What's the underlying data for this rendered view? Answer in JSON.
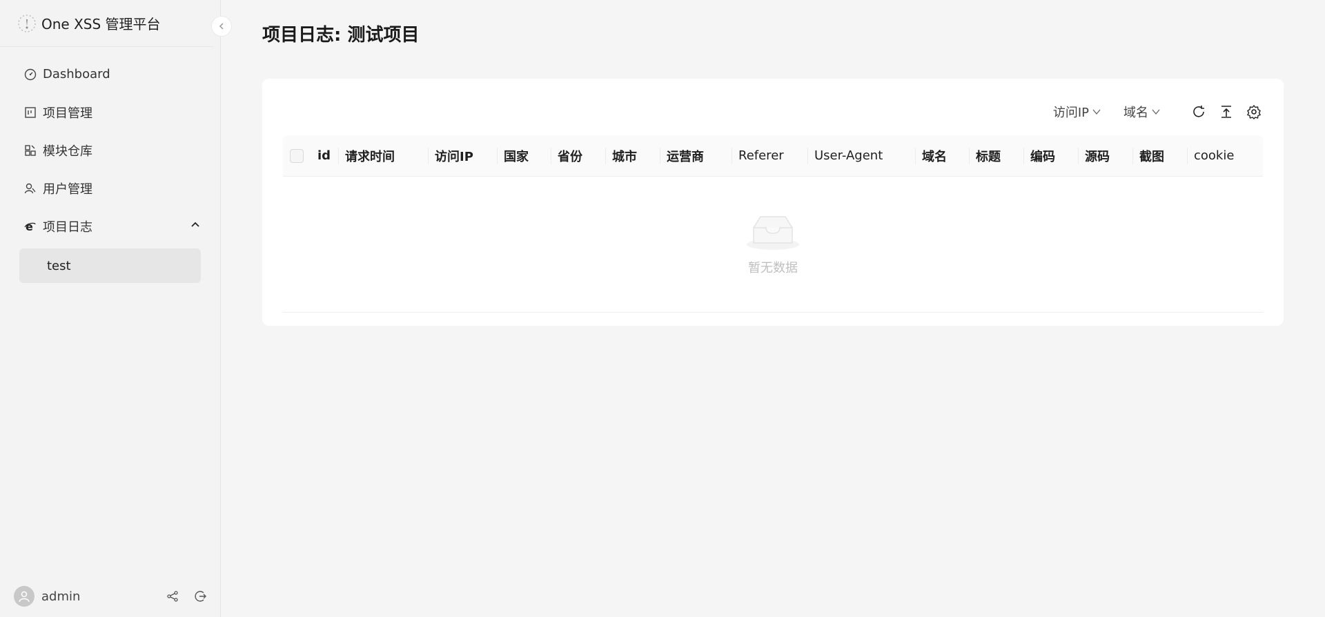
{
  "app": {
    "title": "One XSS 管理平台"
  },
  "sidebar": {
    "items": [
      {
        "label": "Dashboard"
      },
      {
        "label": "项目管理"
      },
      {
        "label": "模块仓库"
      },
      {
        "label": "用户管理"
      },
      {
        "label": "项目日志",
        "expanded": true
      }
    ],
    "subitems": [
      {
        "label": "test",
        "selected": true
      }
    ],
    "user": {
      "name": "admin"
    }
  },
  "main": {
    "title": "项目日志: 测试项目",
    "toolbar": {
      "filter1": "访问IP",
      "filter2": "域名"
    },
    "table": {
      "columns": [
        "id",
        "请求时间",
        "访问IP",
        "国家",
        "省份",
        "城市",
        "运营商",
        "Referer",
        "User-Agent",
        "域名",
        "标题",
        "编码",
        "源码",
        "截图",
        "cookie"
      ],
      "empty_text": "暂无数据"
    }
  },
  "icons": {
    "logo": "logo-icon",
    "collapse": "chevron-left-icon",
    "dashboard": "dashboard-icon",
    "project": "project-icon",
    "module": "module-icon",
    "users": "users-icon",
    "log": "ie-icon",
    "share": "share-icon",
    "logout": "logout-icon",
    "refresh": "refresh-icon",
    "export": "export-icon",
    "settings": "gear-icon"
  },
  "colors": {
    "background": "#f5f5f5",
    "card": "#ffffff",
    "selected": "#e6e6e6"
  }
}
